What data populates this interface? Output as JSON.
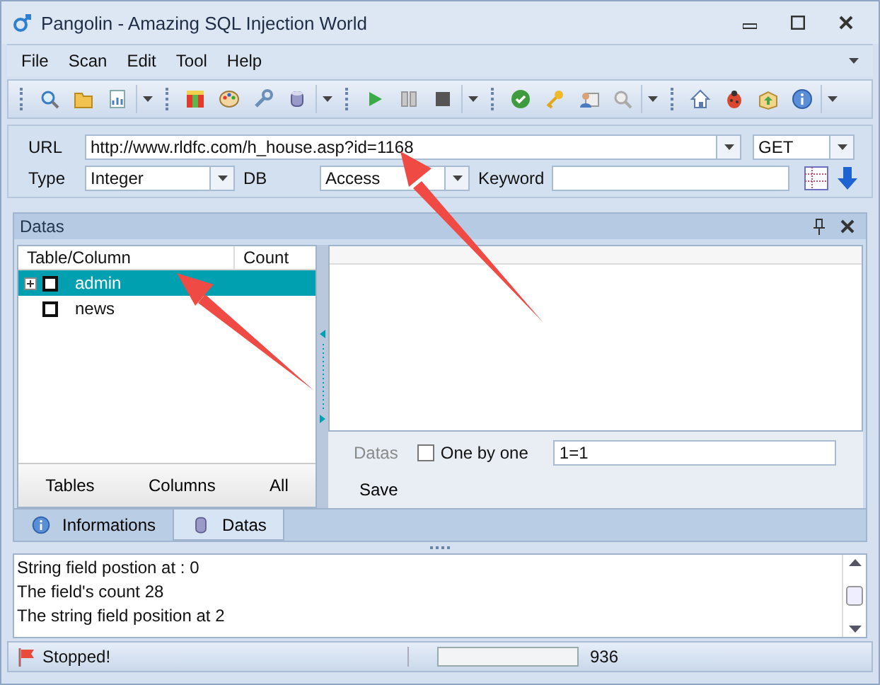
{
  "window": {
    "title": "Pangolin - Amazing SQL Injection World"
  },
  "menu": [
    "File",
    "Scan",
    "Edit",
    "Tool",
    "Help"
  ],
  "request": {
    "url_label": "URL",
    "url": "http://www.rldfc.com/h_house.asp?id=1168",
    "method": "GET",
    "type_label": "Type",
    "type": "Integer",
    "db_label": "DB",
    "db": "Access",
    "keyword_label": "Keyword"
  },
  "datas_panel": {
    "title": "Datas",
    "tree": {
      "columns": [
        "Table/Column",
        "Count"
      ],
      "rows": [
        {
          "kind": "branch",
          "label": "admin",
          "selected": true,
          "checked": false
        },
        {
          "kind": "leaf",
          "label": "news",
          "selected": false,
          "checked": false
        }
      ]
    },
    "tree_buttons": [
      "Tables",
      "Columns",
      "All"
    ],
    "datas_label": "Datas",
    "one_by_one": {
      "label": "One by one",
      "checked": false
    },
    "condition": "1=1",
    "save": "Save"
  },
  "bottom_tabs": [
    {
      "label": "Informations",
      "kind": "info",
      "selected": false
    },
    {
      "label": "Datas",
      "kind": "database",
      "selected": true
    }
  ],
  "log": [
    "String field postion at : 0",
    "The field's count 28",
    "The string field position at 2"
  ],
  "status_bar": {
    "text": "Stopped!",
    "progress": {
      "level": 0
    },
    "count": "936"
  }
}
